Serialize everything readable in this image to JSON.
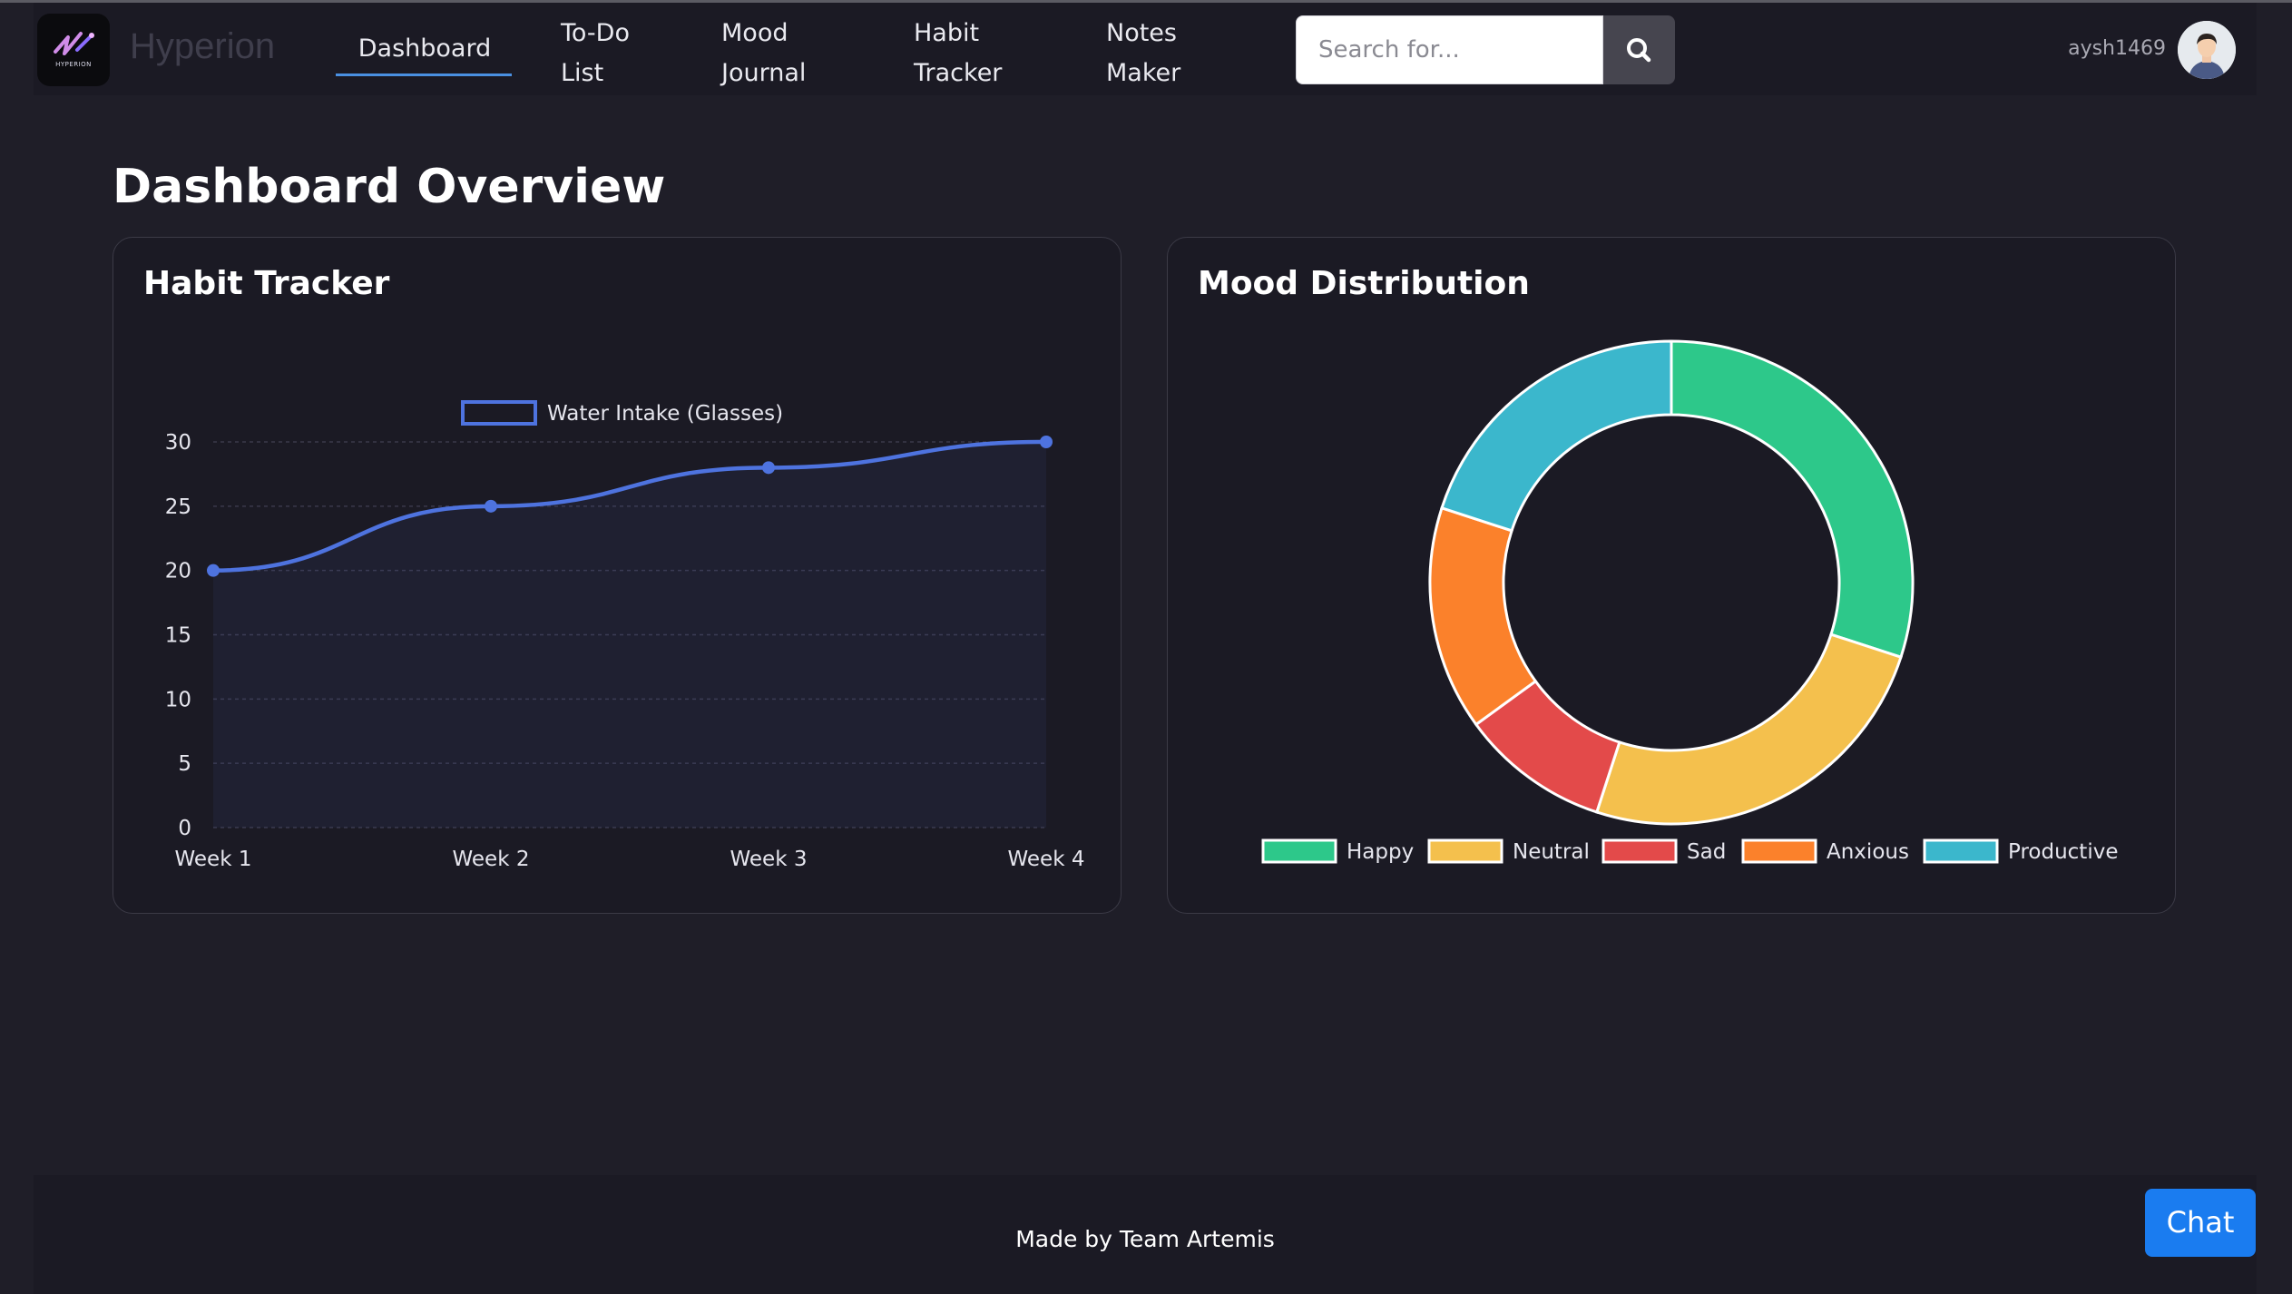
{
  "app": {
    "brand": "Hyperion",
    "logo_text": "HYPERION"
  },
  "nav": {
    "dashboard": "Dashboard",
    "todo_line1": "To-Do",
    "todo_line2": "List",
    "mood_line1": "Mood",
    "mood_line2": "Journal",
    "habit_line1": "Habit",
    "habit_line2": "Tracker",
    "notes_line1": "Notes",
    "notes_line2": "Maker"
  },
  "search": {
    "placeholder": "Search for...",
    "icon": "search-icon"
  },
  "user": {
    "name": "aysh1469",
    "avatar_icon": "user-avatar"
  },
  "page": {
    "title": "Dashboard Overview"
  },
  "cards": {
    "habit_title": "Habit Tracker",
    "mood_title": "Mood Distribution"
  },
  "chart_data": [
    {
      "type": "line",
      "title": "Habit Tracker",
      "categories": [
        "Week 1",
        "Week 2",
        "Week 3",
        "Week 4"
      ],
      "series": [
        {
          "name": "Water Intake (Glasses)",
          "values": [
            20,
            25,
            28,
            30
          ],
          "color": "#4e73df"
        }
      ],
      "ylim": [
        0,
        30
      ],
      "yticks": [
        0,
        5,
        10,
        15,
        20,
        25,
        30
      ],
      "grid": true,
      "legend": "top"
    },
    {
      "type": "pie",
      "title": "Mood Distribution",
      "labels": [
        "Happy",
        "Neutral",
        "Sad",
        "Anxious",
        "Productive"
      ],
      "values": [
        30,
        25,
        10,
        15,
        20
      ],
      "colors": [
        "#2dc88a",
        "#f4c04d",
        "#e34a4a",
        "#fb812b",
        "#3bb7cc"
      ],
      "legend": "bottom"
    }
  ],
  "footer": {
    "text": "Made by Team Artemis"
  },
  "chat": {
    "label": "Chat"
  }
}
